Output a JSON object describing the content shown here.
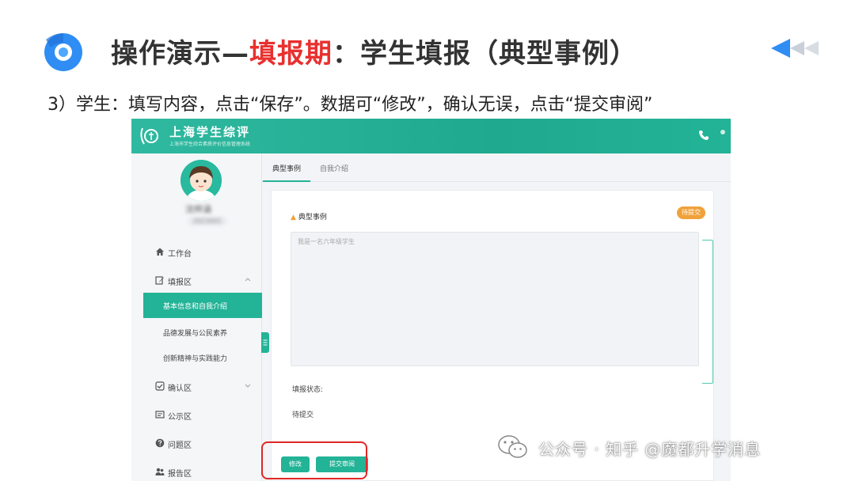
{
  "slide": {
    "title_prefix": "操作演示—",
    "title_highlight": "填报期",
    "title_suffix": "：学生填报（典型事例）",
    "subtitle": "3）学生：填写内容，点击“保存”。数据可“修改”，确认无误，点击“提交审阅”"
  },
  "app": {
    "brand_title": "上海学生综评",
    "brand_subtitle": "上海市学生综合素质评价信息管理系统"
  },
  "sidebar": {
    "user_name": "沈梓涵",
    "user_id": "2023001",
    "items": [
      {
        "label": "工作台",
        "icon": "home-icon"
      },
      {
        "label": "填报区",
        "icon": "edit-icon",
        "expanded": true
      },
      {
        "label": "确认区",
        "icon": "check-icon"
      },
      {
        "label": "公示区",
        "icon": "board-icon"
      },
      {
        "label": "问题区",
        "icon": "question-icon"
      },
      {
        "label": "报告区",
        "icon": "users-icon"
      }
    ],
    "submenu": [
      {
        "label": "基本信息和自我介绍",
        "active": true
      },
      {
        "label": "品德发展与公民素养"
      },
      {
        "label": "创新精神与实践能力"
      }
    ]
  },
  "tabs": [
    {
      "label": "典型事例",
      "active": true
    },
    {
      "label": "自我介绍"
    }
  ],
  "form": {
    "section_title": "典型事例",
    "status_badge": "待提交",
    "textarea_value": "我是一名六年级学生",
    "field_label": "填报状态:",
    "field_value": "待提交",
    "edit_button": "修改",
    "submit_button": "提交审阅"
  },
  "watermark": {
    "text": "公众号 · 知乎 @魔都升学消息"
  },
  "colors": {
    "accent": "#23b397",
    "highlight": "#e8302f",
    "warning": "#f0a13a",
    "callout": "#e02727"
  }
}
